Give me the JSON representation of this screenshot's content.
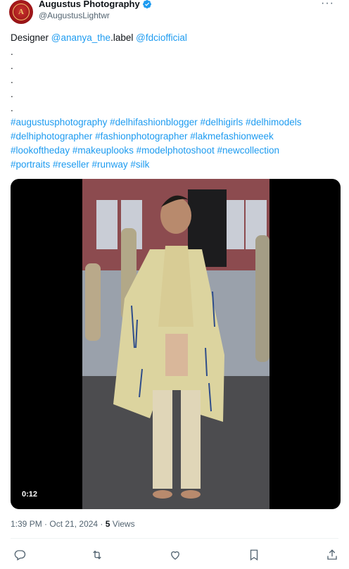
{
  "author": {
    "name": "Augustus Photography",
    "handle": "@AugustusLightwr",
    "verified": true
  },
  "tweet": {
    "prefix": "Designer",
    "mention1": "@ananya_the",
    "mention1_suffix": ".label",
    "mention2": "@fdciofficial",
    "dots": [
      ".",
      ".",
      ".",
      ".",
      "."
    ],
    "hashtag_lines": [
      "#augustusphotography #delhifashionblogger #delhigirls #delhimodels",
      "#delhiphotographer #fashionphotographer #lakmefashionweek",
      "#lookoftheday #makeuplooks #modelphotoshoot #newcollection",
      "#portraits #reseller #runway #silk"
    ]
  },
  "media": {
    "duration": "0:12"
  },
  "meta": {
    "time": "1:39 PM",
    "separator1": " · ",
    "date": "Oct 21, 2024",
    "separator2": " · ",
    "views_count": "5",
    "views_label": " Views"
  },
  "actions": {
    "icons": [
      "reply-icon",
      "retweet-icon",
      "like-icon",
      "bookmark-icon",
      "share-icon"
    ],
    "retweet_count": ""
  },
  "colors": {
    "link": "#1d9bf0",
    "muted": "#536471",
    "text": "#0f1419"
  }
}
